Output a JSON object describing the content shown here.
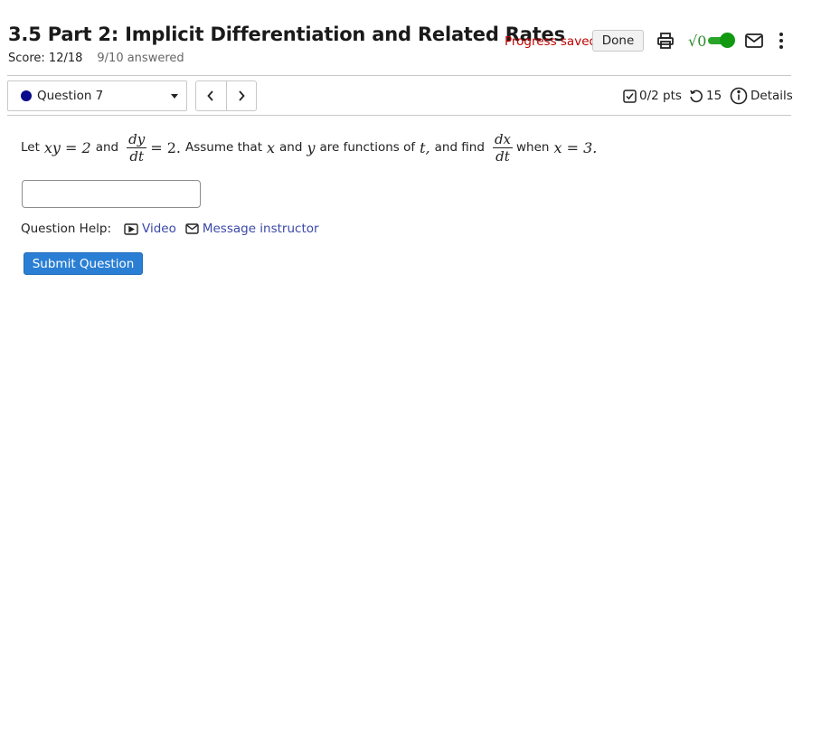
{
  "header": {
    "title": "3.5 Part 2: Implicit Differentiation and Related Rates",
    "score_label": "Score: 12/18",
    "answered_label": "9/10 answered",
    "progress_status": "Progress saved",
    "done_label": "Done",
    "math_toggle_glyph": "√0",
    "colors": {
      "progress": "#c00000",
      "toggle": "#119911"
    }
  },
  "question_nav": {
    "selected_question": "Question 7",
    "prev_glyph": "‹",
    "next_glyph": "›",
    "points": "0/2 pts",
    "attempts": "15",
    "details_label": "Details"
  },
  "question": {
    "let": "Let",
    "eq1": "xy = 2",
    "and1": "and",
    "frac1_num": "dy",
    "frac1_den": "dt",
    "eq2": "= 2.",
    "assume": "Assume that",
    "var_x": "x",
    "and2": "and",
    "var_y": "y",
    "functions_of": "are functions of",
    "var_t": "t,",
    "and_find": "and find",
    "frac2_num": "dx",
    "frac2_den": "dt",
    "when": "when",
    "eq3": "x = 3."
  },
  "answer": {
    "value": ""
  },
  "help": {
    "label": "Question Help:",
    "video_label": "Video",
    "message_label": "Message instructor"
  },
  "submit": {
    "label": "Submit Question",
    "color": "#2a7fd4"
  }
}
